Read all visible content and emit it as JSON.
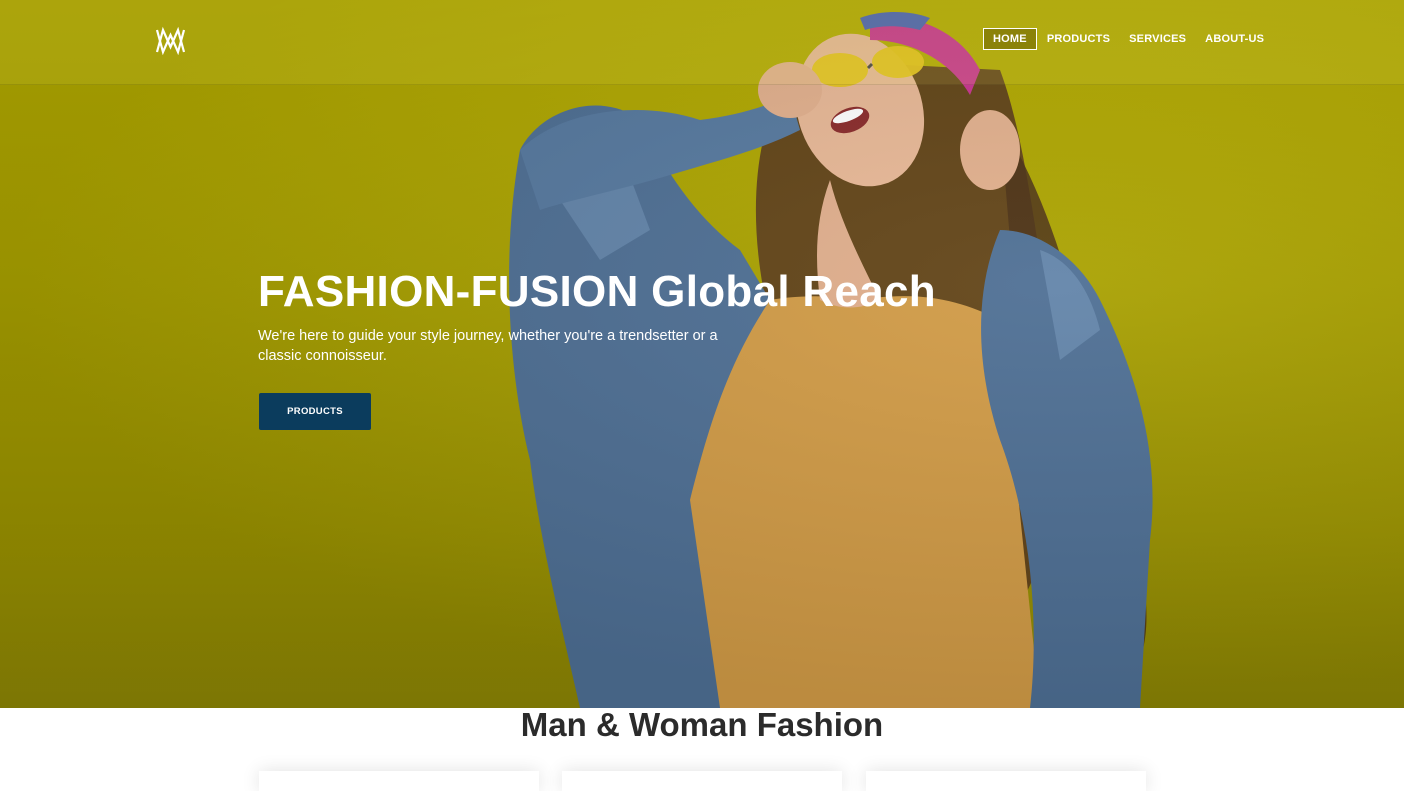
{
  "brand": {
    "logo_icon": "monogram-logo-icon"
  },
  "nav": {
    "items": [
      {
        "label": "HOME",
        "active": true
      },
      {
        "label": "PRODUCTS",
        "active": false
      },
      {
        "label": "SERVICES",
        "active": false
      },
      {
        "label": "ABOUT-US",
        "active": false
      }
    ]
  },
  "hero": {
    "title": "FASHION-FUSION Global Reach",
    "subtitle": "We're here to guide your style journey, whether you're a trendsetter or a classic connoisseur.",
    "cta_label": "PRODUCTS",
    "background_color": "#b5ac00",
    "cta_color": "#0b3c5d"
  },
  "section": {
    "title": "Man & Woman Fashion",
    "cards_visible": 3
  }
}
